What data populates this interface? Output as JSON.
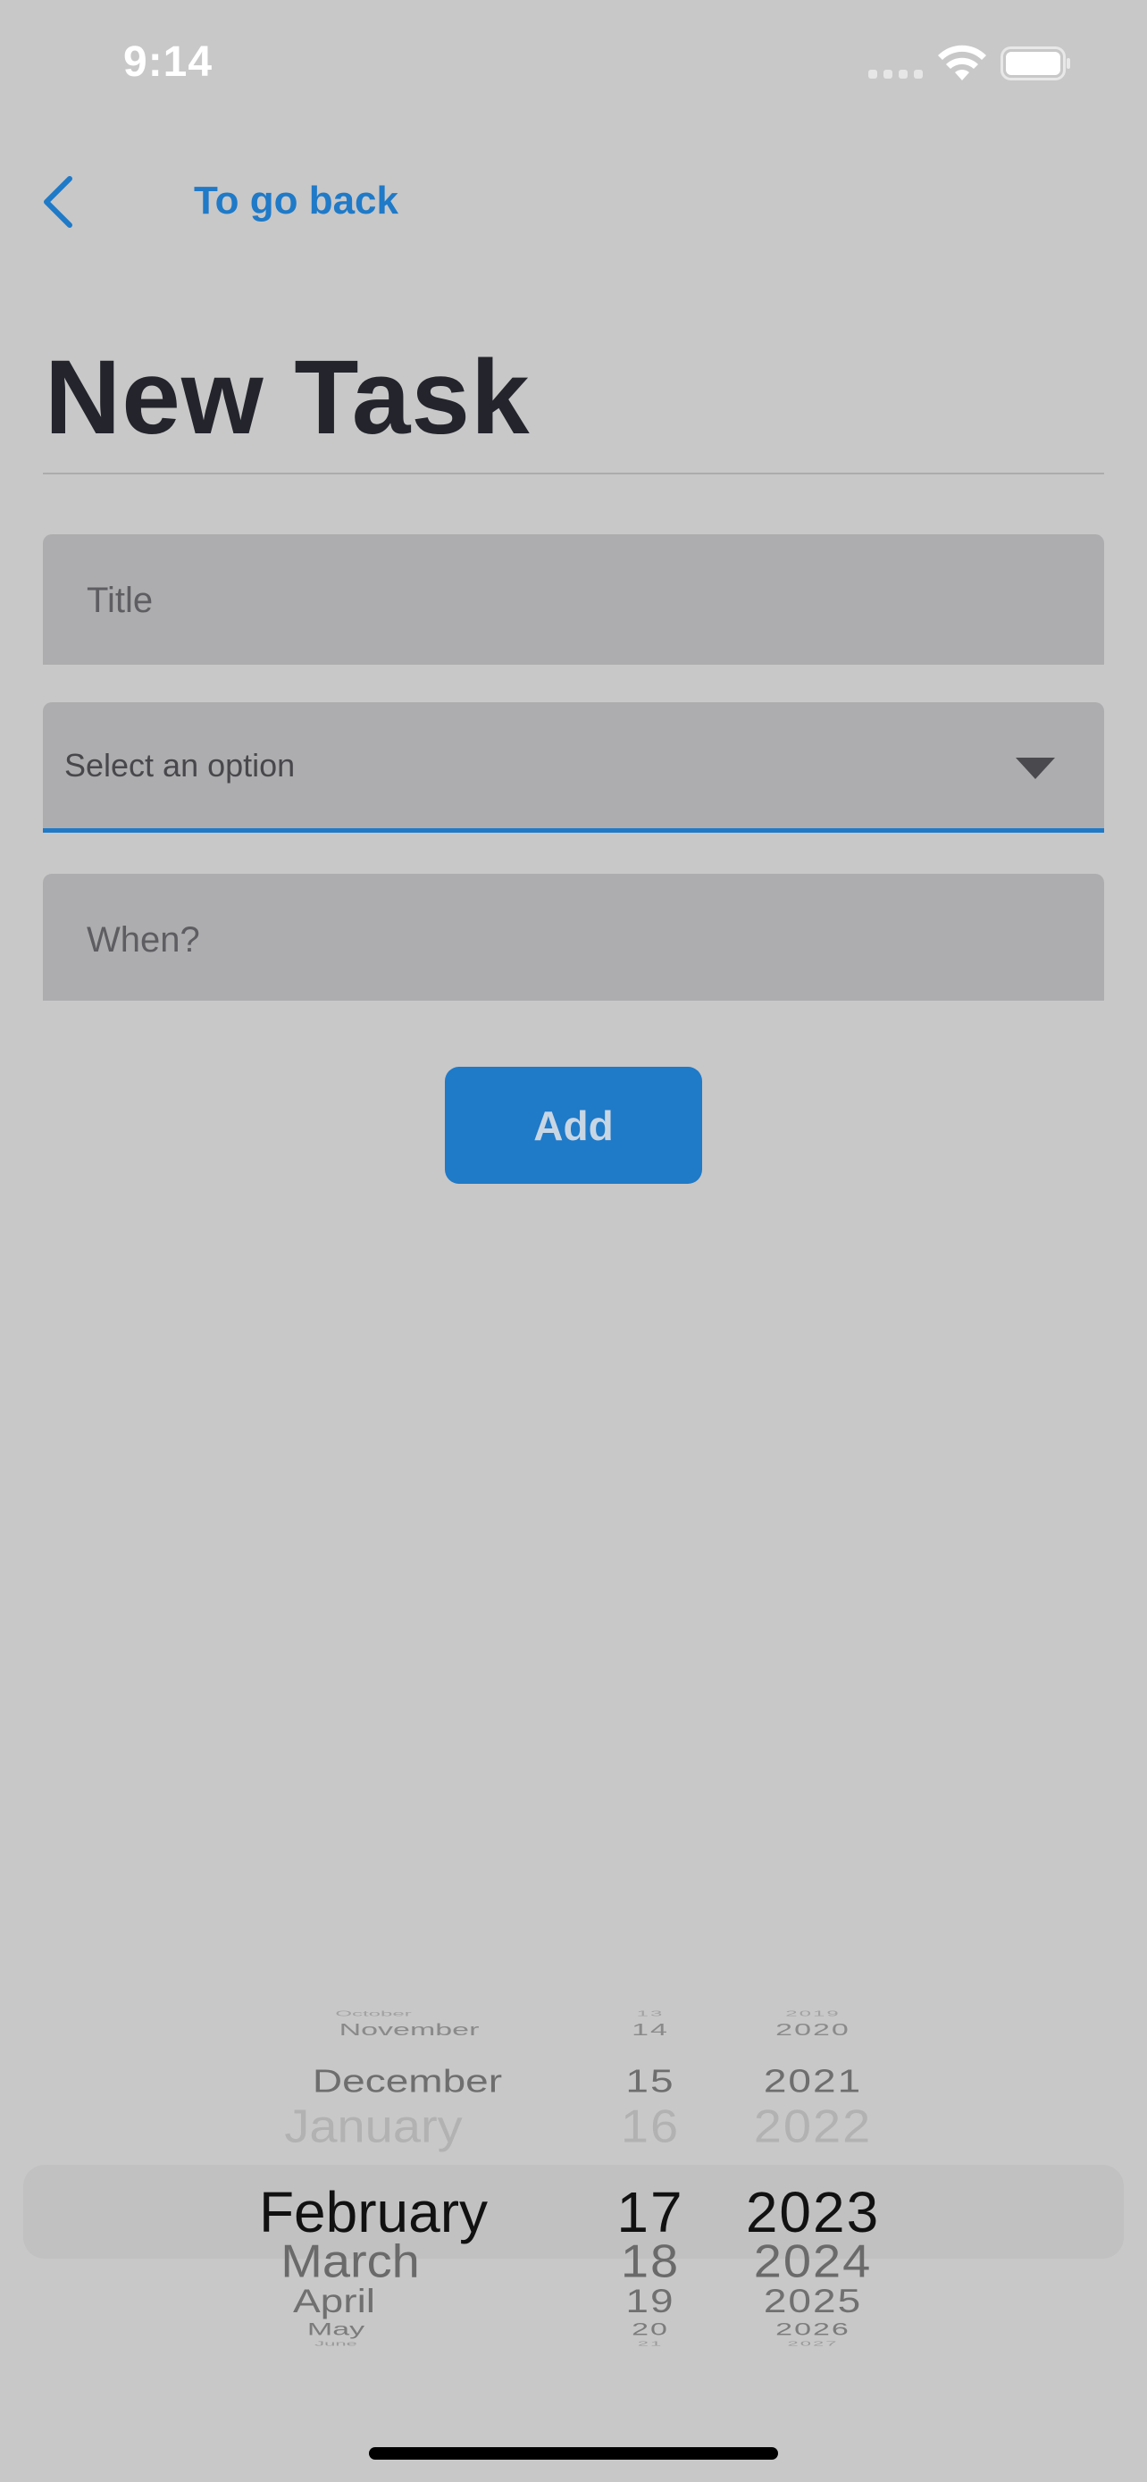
{
  "status_bar": {
    "time": "9:14"
  },
  "nav": {
    "back_label": "To go back"
  },
  "page": {
    "title": "New Task"
  },
  "form": {
    "title_placeholder": "Title",
    "select_placeholder": "Select an option",
    "when_placeholder": "When?",
    "add_label": "Add"
  },
  "date_picker": {
    "selected": {
      "month": "February",
      "day": "17",
      "year": "2023"
    },
    "months": [
      "October",
      "November",
      "December",
      "January",
      "February",
      "March",
      "April",
      "May",
      "June"
    ],
    "days": [
      "13",
      "14",
      "15",
      "16",
      "17",
      "18",
      "19",
      "20",
      "21"
    ],
    "years": [
      "2019",
      "2020",
      "2021",
      "2022",
      "2023",
      "2024",
      "2025",
      "2026",
      "2027"
    ],
    "selected_index": 4
  },
  "colors": {
    "accent": "#1f7ac8",
    "background": "#c8c8c8",
    "field": "#adadaf",
    "title_text": "#23242c"
  }
}
